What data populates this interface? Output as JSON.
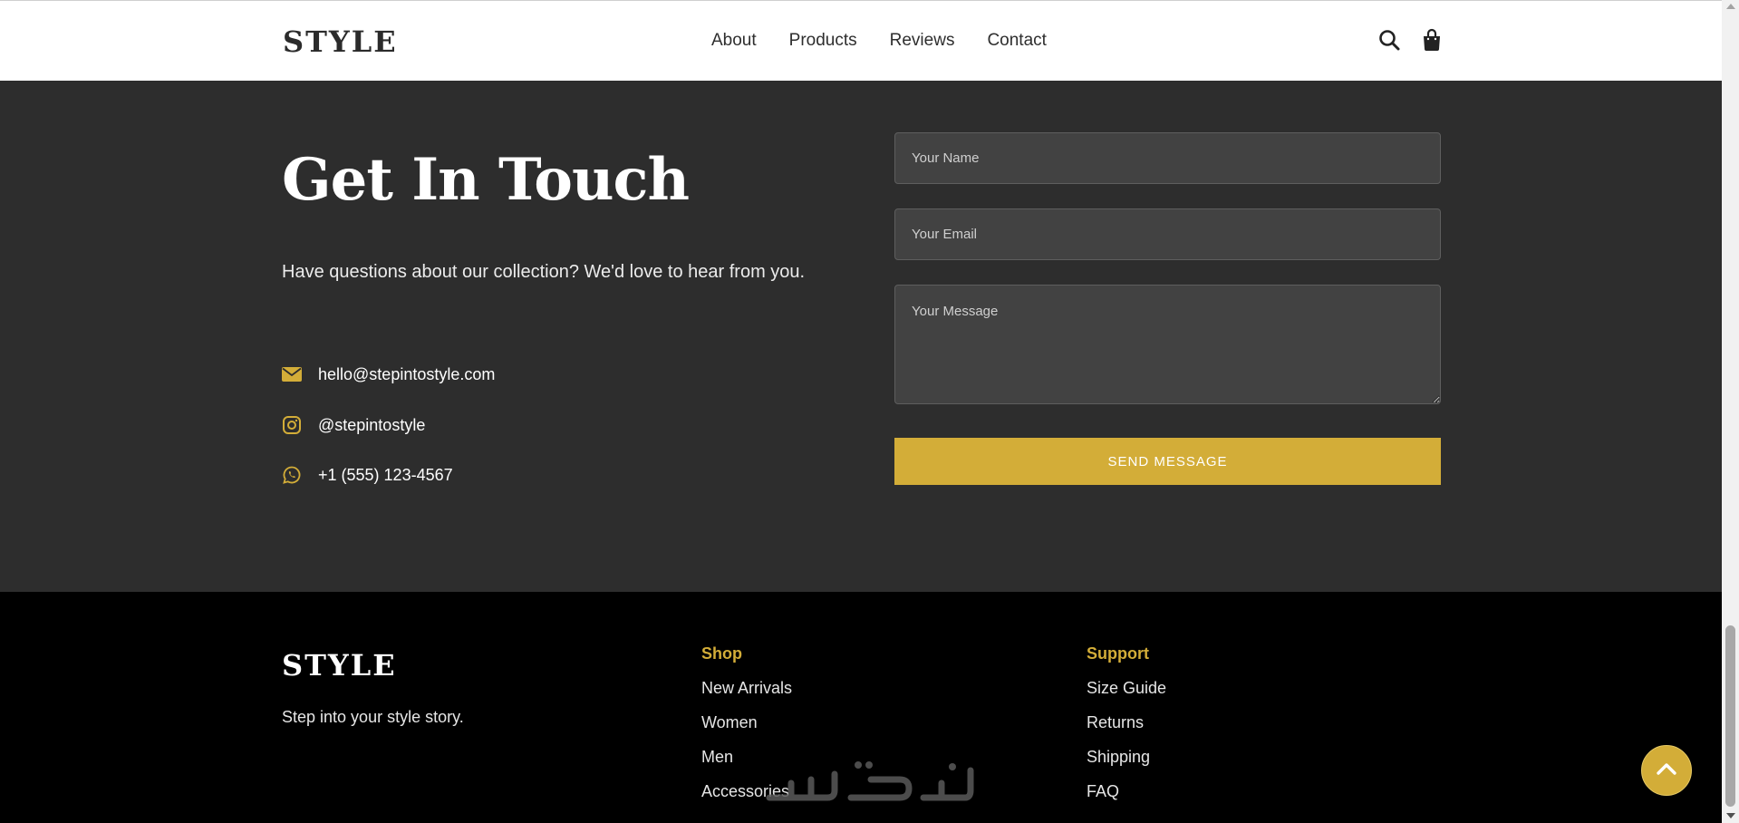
{
  "header": {
    "logo": "STYLE",
    "nav": [
      "About",
      "Products",
      "Reviews",
      "Contact"
    ],
    "icons": [
      "search-icon",
      "shopping-bag-icon"
    ]
  },
  "contact": {
    "title": "Get In Touch",
    "description": "Have questions about our collection? We'd love to hear from you.",
    "email": "hello@stepintostyle.com",
    "instagram": "@stepintostyle",
    "phone": "+1 (555) 123-4567",
    "form": {
      "name_placeholder": "Your Name",
      "email_placeholder": "Your Email",
      "message_placeholder": "Your Message",
      "submit_label": "SEND MESSAGE"
    }
  },
  "footer": {
    "logo": "STYLE",
    "tagline": "Step into your style story.",
    "shop": {
      "heading": "Shop",
      "links": [
        "New Arrivals",
        "Women",
        "Men",
        "Accessories"
      ]
    },
    "support": {
      "heading": "Support",
      "links": [
        "Size Guide",
        "Returns",
        "Shipping",
        "FAQ"
      ]
    }
  },
  "colors": {
    "accent": "#d3ad38",
    "section_bg": "#2d2d2d",
    "footer_bg": "#000000",
    "header_bg": "#ffffff"
  }
}
